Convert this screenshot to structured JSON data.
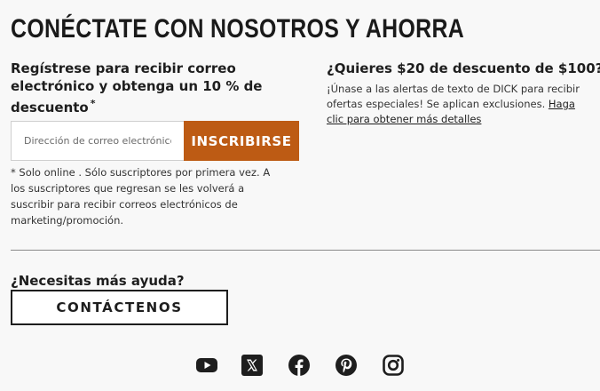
{
  "title": "CONÉCTATE CON NOSOTROS Y AHORRA",
  "signup": {
    "heading": "Regístrese para recibir correo electrónico y obtenga un 10 % de descuento",
    "asterisk": "*",
    "email_placeholder": "Dirección de correo electrónico",
    "subscribe_label": "INSCRIBIRSE",
    "disclaimer": "* Solo online . Sólo suscriptores por primera vez. A los suscriptores que regresan se les volverá a suscribir para recibir correos electrónicos de marketing/promoción."
  },
  "sms": {
    "heading": "¿Quieres $20 de descuento de $100?",
    "text": "¡Únase a las alertas de texto de DICK para recibir ofertas especiales! Se aplican exclusiones.",
    "link": "Haga clic para obtener más detalles"
  },
  "help": {
    "heading": "¿Necesitas más ayuda?",
    "contact_label": "CONTÁCTENOS"
  },
  "social": {
    "icons": [
      "youtube-icon",
      "x-icon",
      "facebook-icon",
      "pinterest-icon",
      "instagram-icon"
    ]
  },
  "colors": {
    "accent": "#bd5b14",
    "text": "#1e1e1e",
    "background": "#f8f8f8"
  }
}
